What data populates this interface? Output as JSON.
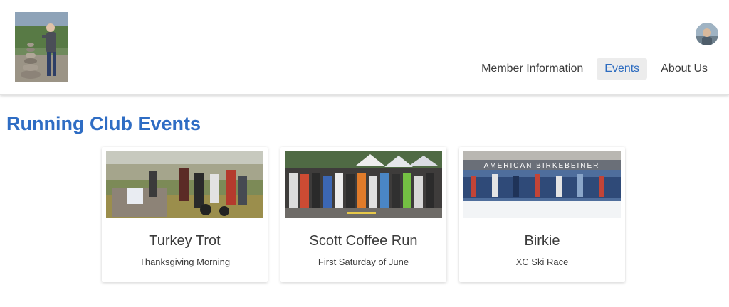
{
  "nav": {
    "items": [
      {
        "label": "Member Information",
        "active": false
      },
      {
        "label": "Events",
        "active": true
      },
      {
        "label": "About Us",
        "active": false
      }
    ]
  },
  "page": {
    "title": "Running Club Events"
  },
  "events": [
    {
      "title": "Turkey Trot",
      "subtitle": "Thanksgiving Morning"
    },
    {
      "title": "Scott Coffee Run",
      "subtitle": "First Saturday of June"
    },
    {
      "title": "Birkie",
      "subtitle": "XC Ski Race",
      "banner": "AMERICAN BIRKEBEINER"
    }
  ],
  "colors": {
    "accent": "#2f6dc4",
    "nav_active_bg": "#ececec"
  }
}
